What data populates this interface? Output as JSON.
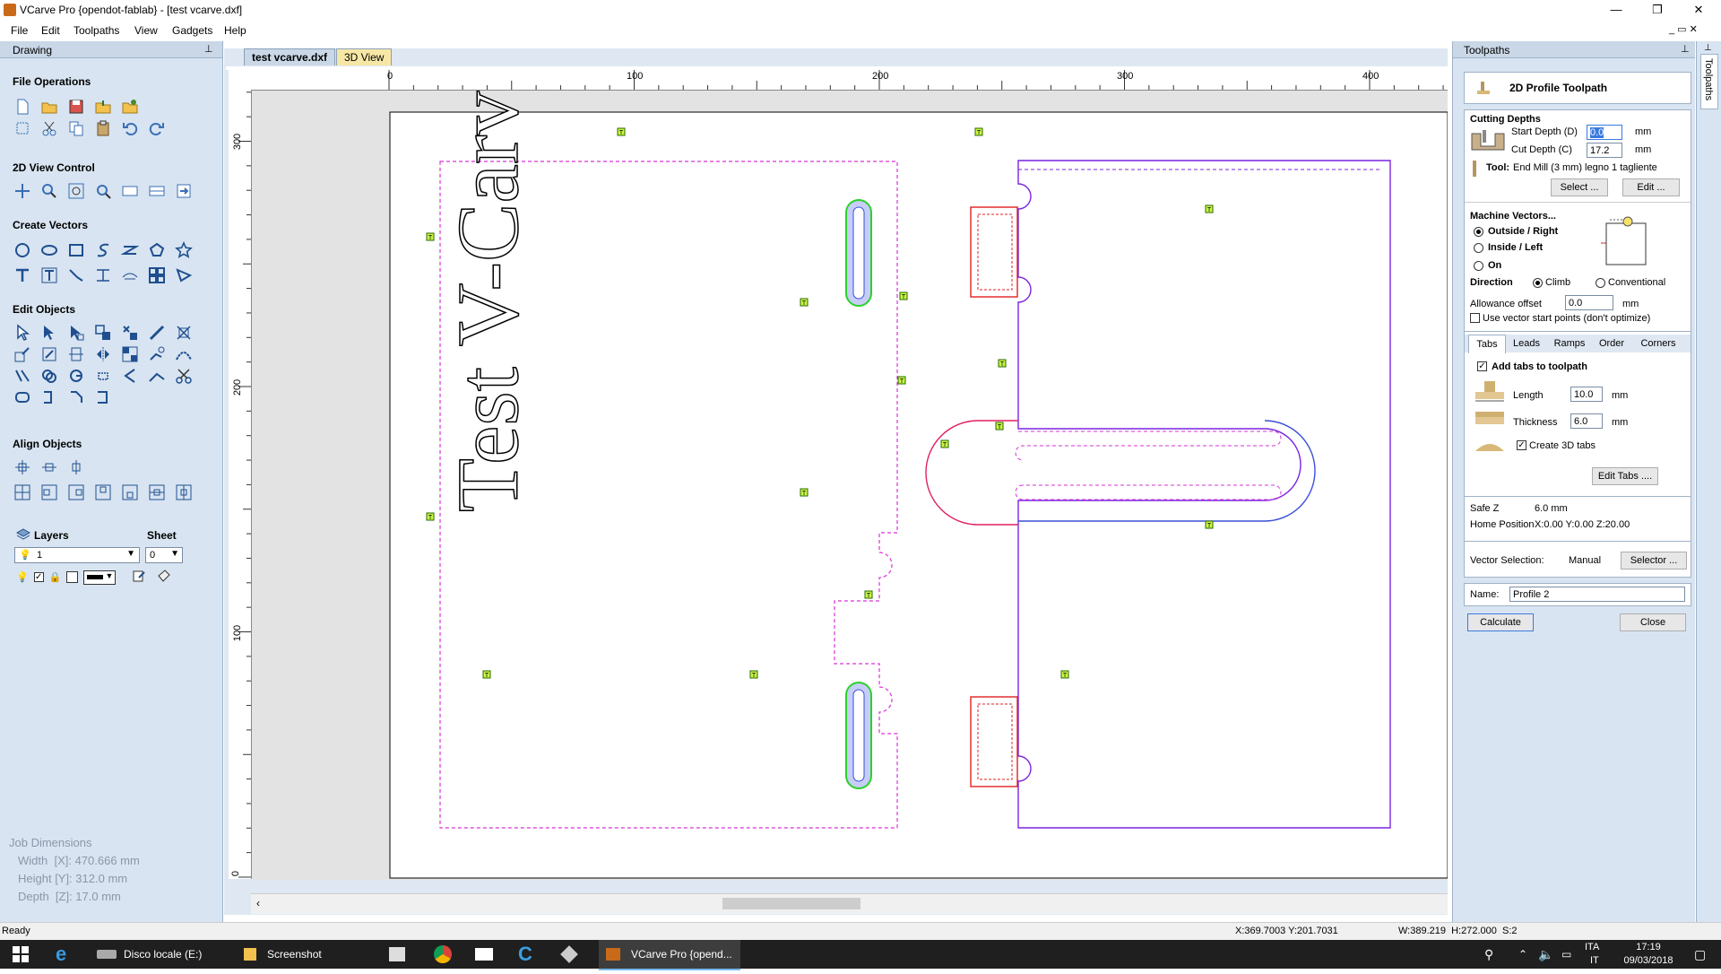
{
  "window": {
    "title": "VCarve Pro {opendot-fablab} - [test vcarve.dxf]",
    "controls": {
      "minimize": "—",
      "restore": "❐",
      "close": "✕"
    }
  },
  "menu": [
    "File",
    "Edit",
    "Toolpaths",
    "View",
    "Gadgets",
    "Help"
  ],
  "left_panel": {
    "header": "Drawing",
    "sections": {
      "file_operations": "File Operations",
      "view_control": "2D View Control",
      "create_vectors": "Create Vectors",
      "edit_objects": "Edit Objects",
      "align_objects": "Align Objects"
    },
    "layers_label": "Layers",
    "sheet_label": "Sheet",
    "layer_value": "1",
    "sheet_value": "0",
    "job_dimensions": {
      "title": "Job Dimensions",
      "width": "Width  [X]: 470.666 mm",
      "height": "Height [Y]: 312.0 mm",
      "depth": "Depth  [Z]: 17.0 mm"
    }
  },
  "doc_tabs": [
    "test vcarve.dxf",
    "3D View"
  ],
  "ruler": {
    "top": [
      "0",
      "100",
      "200",
      "300",
      "400"
    ],
    "left": [
      "300",
      "200",
      "100",
      "0"
    ]
  },
  "canvas": {
    "text": "Test V-Carve",
    "tab_marker": "T"
  },
  "right_panel": {
    "header": "Toolpaths",
    "title": "2D Profile Toolpath",
    "cutting_depths": {
      "title": "Cutting Depths",
      "start_label": "Start Depth (D)",
      "start_value": "0.0",
      "cut_label": "Cut Depth (C)",
      "cut_value": "17.2",
      "unit": "mm"
    },
    "tool": {
      "label": "Tool:",
      "value": "End Mill (3 mm) legno 1 tagliente",
      "select": "Select ...",
      "edit": "Edit ..."
    },
    "machine_vectors": {
      "title": "Machine Vectors...",
      "outside": "Outside / Right",
      "inside": "Inside / Left",
      "on": "On"
    },
    "direction": {
      "label": "Direction",
      "climb": "Climb",
      "conventional": "Conventional"
    },
    "allowance": {
      "label": "Allowance offset",
      "value": "0.0",
      "unit": "mm"
    },
    "vector_start": "Use vector start points (don't optimize)",
    "tabs_bar": [
      "Tabs",
      "Leads",
      "Ramps",
      "Order",
      "Corners"
    ],
    "tabs": {
      "add": "Add tabs to toolpath",
      "length_label": "Length",
      "length_value": "10.0",
      "thickness_label": "Thickness",
      "thickness_value": "6.0",
      "unit": "mm",
      "create3d": "Create 3D tabs",
      "edit": "Edit Tabs ...."
    },
    "safe_z": {
      "label": "Safe Z",
      "value": "6.0 mm"
    },
    "home": {
      "label": "Home Position",
      "value": "X:0.00 Y:0.00 Z:20.00"
    },
    "vector_selection": {
      "label": "Vector Selection:",
      "value": "Manual",
      "selector": "Selector ..."
    },
    "name": {
      "label": "Name:",
      "value": "Profile 2"
    },
    "calculate": "Calculate",
    "close": "Close",
    "side_tab": "Toolpaths"
  },
  "status": {
    "left": "Ready",
    "coords": "X:369.7003 Y:201.7031",
    "size": "W:389.219  H:272.000  S:2"
  },
  "taskbar": {
    "items": [
      "Disco locale (E:)",
      "Screenshot",
      "VCarve Pro {opend..."
    ],
    "lang": "ITA",
    "lang2": "IT",
    "time": "17:19",
    "date": "09/03/2018"
  }
}
